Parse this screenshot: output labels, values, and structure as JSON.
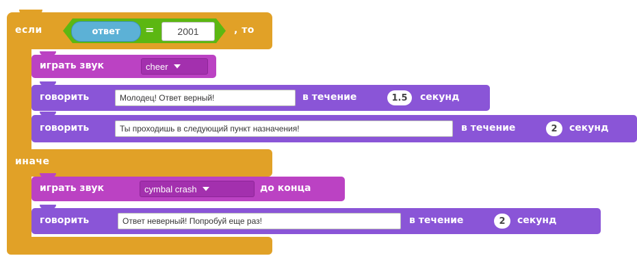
{
  "if_block": {
    "if_label": "если",
    "then_label": ", то",
    "else_label": "иначе",
    "condition": {
      "sensor_label": "ответ",
      "operator": "=",
      "value": "2001"
    }
  },
  "then_blocks": [
    {
      "label_main": "играть звук",
      "sound": "cheer"
    },
    {
      "label_main": "говорить",
      "text": "Молодец! Ответ верный!",
      "for_label": "в течение",
      "secs": "1.5",
      "unit": "секунд"
    },
    {
      "label_main": "говорить",
      "text": "Ты проходишь в следующий пункт назначения!",
      "for_label": "в течение",
      "secs": "2",
      "unit": "секунд"
    }
  ],
  "else_blocks": [
    {
      "label_main": "играть звук",
      "sound": "cymbal crash",
      "until_label": "до конца"
    },
    {
      "label_main": "говорить",
      "text": "Ответ неверный! Попробуй еще раз!",
      "for_label": "в течение",
      "secs": "2",
      "unit": "секунд"
    }
  ],
  "colors": {
    "control": "#e1a127",
    "operator": "#5cb712",
    "sensing": "#5cb1d6",
    "sound": "#bb42c3",
    "looks": "#8a55d7"
  }
}
